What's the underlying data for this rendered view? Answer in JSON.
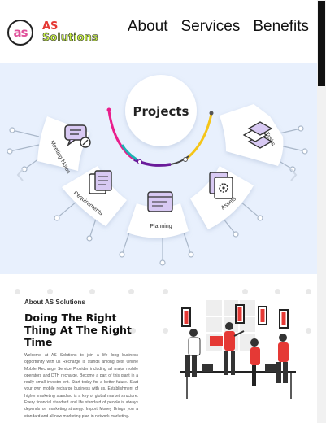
{
  "brand": {
    "logo_mark": "as",
    "line1": "AS",
    "line2": "Solutions"
  },
  "nav": {
    "about": "About",
    "services": "Services",
    "benefits": "Benefits"
  },
  "hero": {
    "center_label": "Projects",
    "segments": [
      {
        "label": "Meeting Notes",
        "icon": "chat-note-icon"
      },
      {
        "label": "Requirements",
        "icon": "documents-icon"
      },
      {
        "label": "Planning",
        "icon": "planning-window-icon"
      },
      {
        "label": "Assets",
        "icon": "gear-file-icon"
      },
      {
        "label": "Tasks",
        "icon": "layers-icon"
      }
    ],
    "colors": {
      "background": "#e8f0fd",
      "arc_pink": "#e91e8c",
      "arc_teal": "#19b3b3",
      "arc_purple": "#6a1b9a",
      "arc_yellow": "#f5c518"
    }
  },
  "about": {
    "label": "About AS Solutions",
    "title": "Doing The Right Thing At The Right Time",
    "body": "Welcome at AS Solutions to join a life long business opportunity with us Recharge is stands among best Online Mobile Recharge Service Provider including all major mobile operators and DTH recharge. Become a part of this giant in a really small investm ent. Start today for a better future. Start your own mobile recharge business with us. Establishment of higher marketing standard is a key of global market structure. Every financial standard and life standard of people is always depends on marketing strategy. Import Money Brings you a standard and all new marketing plan in network marketing."
  }
}
